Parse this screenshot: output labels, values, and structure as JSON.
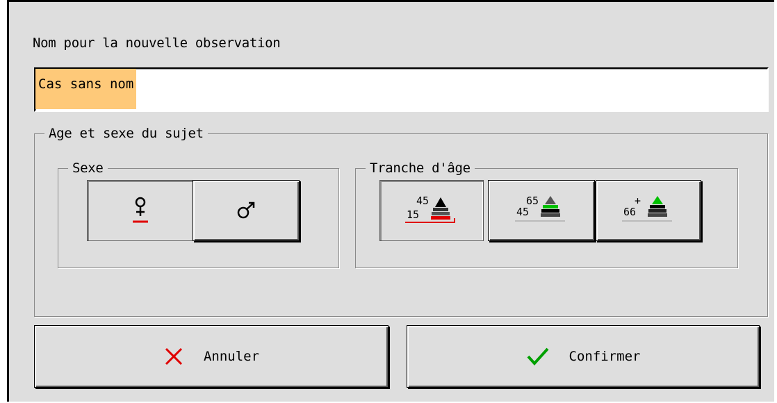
{
  "dialog": {
    "name_label": "Nom pour la nouvelle observation",
    "name_value": "Cas sans nom"
  },
  "age_sex": {
    "title": "Age et sexe du sujet",
    "sex": {
      "title": "Sexe",
      "options": [
        {
          "icon": "female-symbol-icon",
          "selected": true
        },
        {
          "icon": "male-symbol-icon",
          "selected": false
        }
      ]
    },
    "age": {
      "title": "Tranche d'âge",
      "options": [
        {
          "icon": "age-pyramid-icon",
          "upper": "45",
          "lower": "15",
          "selected": true
        },
        {
          "icon": "age-pyramid-icon",
          "upper": "65",
          "lower": "45",
          "selected": false
        },
        {
          "icon": "age-pyramid-icon",
          "upper": "+",
          "lower": "66",
          "selected": false
        }
      ]
    }
  },
  "actions": {
    "cancel_label": "Annuler",
    "confirm_label": "Confirmer"
  },
  "colors": {
    "selection_highlight": "#fec979",
    "accent_red": "#e00000",
    "accent_green": "#00c000",
    "dialog_bg": "#dedede"
  }
}
